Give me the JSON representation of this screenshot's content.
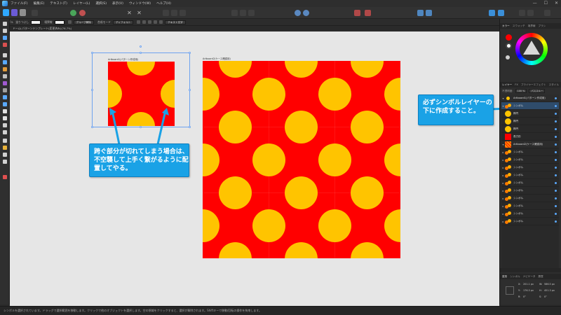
{
  "menu": {
    "items": [
      "ファイル(F)",
      "編集(E)",
      "テキスト(T)",
      "レイヤー(L)",
      "選択(S)",
      "表示(V)",
      "ウィンドウ(W)",
      "ヘルプ(H)"
    ]
  },
  "window": {
    "minimize": "—",
    "maximize": "☐",
    "close": "✕"
  },
  "context_toolbar": {
    "tool_name": "シンボル",
    "fill_label": "塗りつぶし",
    "stroke_label": "境界線",
    "group_label": "グループ解除",
    "blend_label": "合成モード",
    "blend_value": "ディフォルト",
    "text_button": "テキスト文字"
  },
  "document_tab": {
    "title": "ドームLパターンテンプレート(変更済み)(76.7%)"
  },
  "canvas": {
    "small_artboard_label": "Artboard1(パターン作成用)",
    "big_artboard_label": "Artboard2(ケース確認用)"
  },
  "callouts": {
    "left_lines": [
      "跨ぐ部分が切れてしまう場合は、",
      "不空襲して上手く繋がるように配",
      "置してやる。"
    ],
    "right_lines": [
      "必ずシンボルレイヤーの",
      "下に作成すること。"
    ]
  },
  "right_panel": {
    "top_tabs": [
      "カラー",
      "スウォッチ",
      "境界線",
      "ブラシ"
    ],
    "layer_tabs": [
      "レイヤー",
      "FX",
      "ブライヤーエフェクト",
      "スタイル"
    ],
    "opacity_label": "不透明度:",
    "opacity_value": "100 %",
    "blend_value": "パススルー",
    "layers": [
      {
        "name": "Artboard1(パターン作成用)",
        "thumb": "red-dots",
        "expand": "▾",
        "state": "dim"
      },
      {
        "name": "シンボル",
        "thumb": "sym",
        "expand": "▾",
        "state": "selected"
      },
      {
        "name": "楕円",
        "thumb": "yellow",
        "expand": "",
        "state": "normal"
      },
      {
        "name": "楕円",
        "thumb": "yellow",
        "expand": "",
        "state": "normal"
      },
      {
        "name": "楕円",
        "thumb": "yellow",
        "expand": "",
        "state": "normal"
      },
      {
        "name": "長方形",
        "thumb": "red",
        "expand": "",
        "state": "normal"
      },
      {
        "name": "Artboard2(ケース確認用)",
        "thumb": "grid",
        "expand": "▾",
        "state": "dim"
      },
      {
        "name": "シンボル",
        "thumb": "sym",
        "expand": "▸",
        "state": "normal"
      },
      {
        "name": "シンボル",
        "thumb": "sym",
        "expand": "▸",
        "state": "normal"
      },
      {
        "name": "シンボル",
        "thumb": "sym",
        "expand": "▸",
        "state": "normal"
      },
      {
        "name": "シンボル",
        "thumb": "sym",
        "expand": "▸",
        "state": "normal"
      },
      {
        "name": "シンボル",
        "thumb": "sym",
        "expand": "▸",
        "state": "normal"
      },
      {
        "name": "シンボル",
        "thumb": "sym",
        "expand": "▸",
        "state": "normal"
      },
      {
        "name": "シンボル",
        "thumb": "sym",
        "expand": "▸",
        "state": "normal"
      },
      {
        "name": "シンボル",
        "thumb": "sym",
        "expand": "▸",
        "state": "normal"
      },
      {
        "name": "シンボル",
        "thumb": "sym",
        "expand": "▸",
        "state": "normal"
      },
      {
        "name": "シンボル",
        "thumb": "sym",
        "expand": "▸",
        "state": "normal"
      }
    ],
    "bottom_tabs": [
      "変形",
      "シンボル",
      "ナビゲータ",
      "履歴"
    ],
    "transform": {
      "x_label": "X:",
      "x_value": "201.1 px",
      "y_label": "Y:",
      "y_value": "176.3 px",
      "w_label": "W:",
      "w_value": "586.5 px",
      "h_label": "H:",
      "h_value": "451.3 px",
      "r_label": "R:",
      "r_value": "0°",
      "s_label": "S:",
      "s_value": "0°"
    }
  },
  "status": {
    "text": "シンボルを選択されています。ドラッグで選択範囲を移動します。クリックで他のオブジェクトを選択します。空の領域をクリックすると、選択が解除されます。Shiftキーで移動/回転の操作を拘束します。"
  },
  "colors": {
    "pattern_red": "#ff0000",
    "pattern_yellow": "#ffc400",
    "callout_blue": "#1aa2e6",
    "canvas_bg": "#e6e6e6"
  }
}
